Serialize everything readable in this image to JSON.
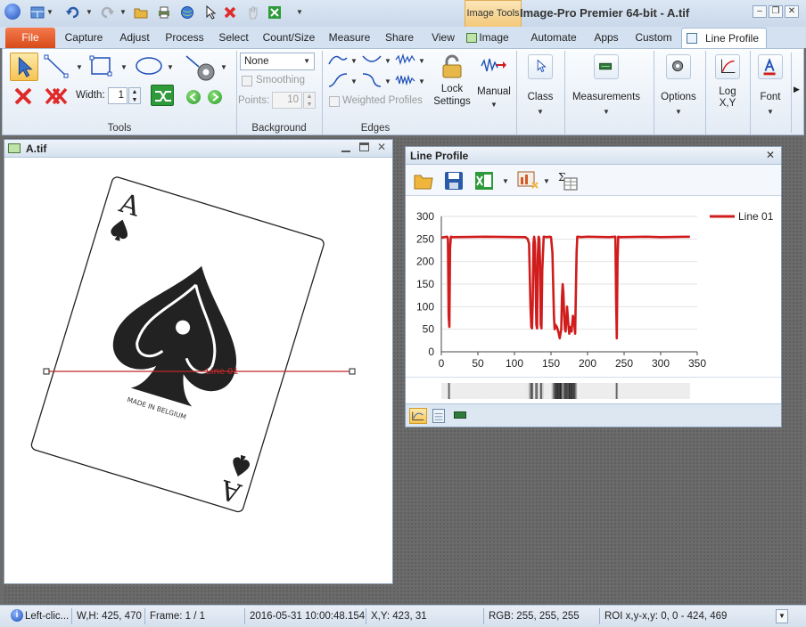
{
  "app": {
    "title": "Image-Pro  Premier  64-bit  -  A.tif",
    "context_tab_group": "Image Tools"
  },
  "tabs": [
    {
      "label": "File"
    },
    {
      "label": "Capture"
    },
    {
      "label": "Adjust"
    },
    {
      "label": "Process"
    },
    {
      "label": "Select"
    },
    {
      "label": "Count/Size"
    },
    {
      "label": "Measure"
    },
    {
      "label": "Share"
    },
    {
      "label": "View"
    },
    {
      "label": "Image"
    },
    {
      "label": "Automate"
    },
    {
      "label": "Apps"
    },
    {
      "label": "Custom"
    },
    {
      "label": "Line Profile"
    }
  ],
  "ribbon": {
    "tools": {
      "group_label": "Tools",
      "width_label": "Width:",
      "width_value": "1"
    },
    "background": {
      "group_label": "Background",
      "method_value": "None",
      "smoothing_label": "Smoothing",
      "points_label": "Points:",
      "points_value": "10"
    },
    "edges": {
      "group_label": "Edges",
      "weighted_label": "Weighted Profiles"
    },
    "lock_settings": "Lock\nSettings",
    "manual": "Manual",
    "class": "Class",
    "measurements": "Measurements",
    "options": "Options",
    "logxy": "Log\nX,Y",
    "font": "Font"
  },
  "image_window": {
    "title": "A.tif",
    "line_label": "Line 01",
    "card_text": "MADE IN BELGIUM",
    "card_rank": "A"
  },
  "line_profile_window": {
    "title": "Line Profile"
  },
  "chart_data": {
    "type": "line",
    "title": "",
    "xlabel": "",
    "ylabel": "",
    "xlim": [
      0,
      350
    ],
    "ylim": [
      0,
      300
    ],
    "x_ticks": [
      0,
      50,
      100,
      150,
      200,
      250,
      300,
      350
    ],
    "y_ticks": [
      0,
      50,
      100,
      150,
      200,
      250,
      300
    ],
    "legend": "top-right",
    "grid": true,
    "series": [
      {
        "name": "Line 01",
        "color": "#d01c1c",
        "x": [
          0,
          8,
          9,
          10,
          11,
          12,
          13,
          15,
          60,
          115,
          118,
          120,
          122,
          123,
          124,
          125,
          126,
          127,
          128,
          130,
          131,
          132,
          133,
          134,
          135,
          136,
          137,
          138,
          140,
          145,
          148,
          150,
          152,
          154,
          155,
          156,
          158,
          160,
          162,
          164,
          165,
          166,
          167,
          168,
          169,
          170,
          172,
          174,
          175,
          176,
          178,
          180,
          182,
          183,
          185,
          186,
          187,
          188,
          190,
          200,
          230,
          238,
          239,
          240,
          241,
          242,
          244,
          280,
          300,
          340
        ],
        "y": [
          253,
          255,
          250,
          80,
          55,
          230,
          255,
          254,
          255,
          254,
          250,
          240,
          100,
          55,
          52,
          110,
          240,
          255,
          240,
          60,
          52,
          210,
          255,
          250,
          200,
          60,
          52,
          180,
          255,
          254,
          255,
          254,
          220,
          80,
          50,
          60,
          55,
          45,
          30,
          50,
          120,
          150,
          130,
          80,
          50,
          45,
          100,
          55,
          40,
          55,
          45,
          80,
          60,
          40,
          220,
          255,
          254,
          255,
          254,
          255,
          254,
          255,
          120,
          30,
          200,
          255,
          254,
          255,
          254,
          255
        ]
      }
    ]
  },
  "status": {
    "hint": "Left-clic...",
    "wh": "W,H: 425, 470",
    "frame": "Frame: 1 / 1",
    "datetime": "2016-05-31 10:00:48.154",
    "xy": "X,Y:  423,   31",
    "rgb": "RGB:   255,   255,   255",
    "roi": "ROI x,y-x,y:    0,     0 -  424,  469"
  },
  "colors": {
    "accent": "#d84a1a",
    "ribbon_bg": "#e3ebf5",
    "profile_line": "#d01c1c"
  }
}
